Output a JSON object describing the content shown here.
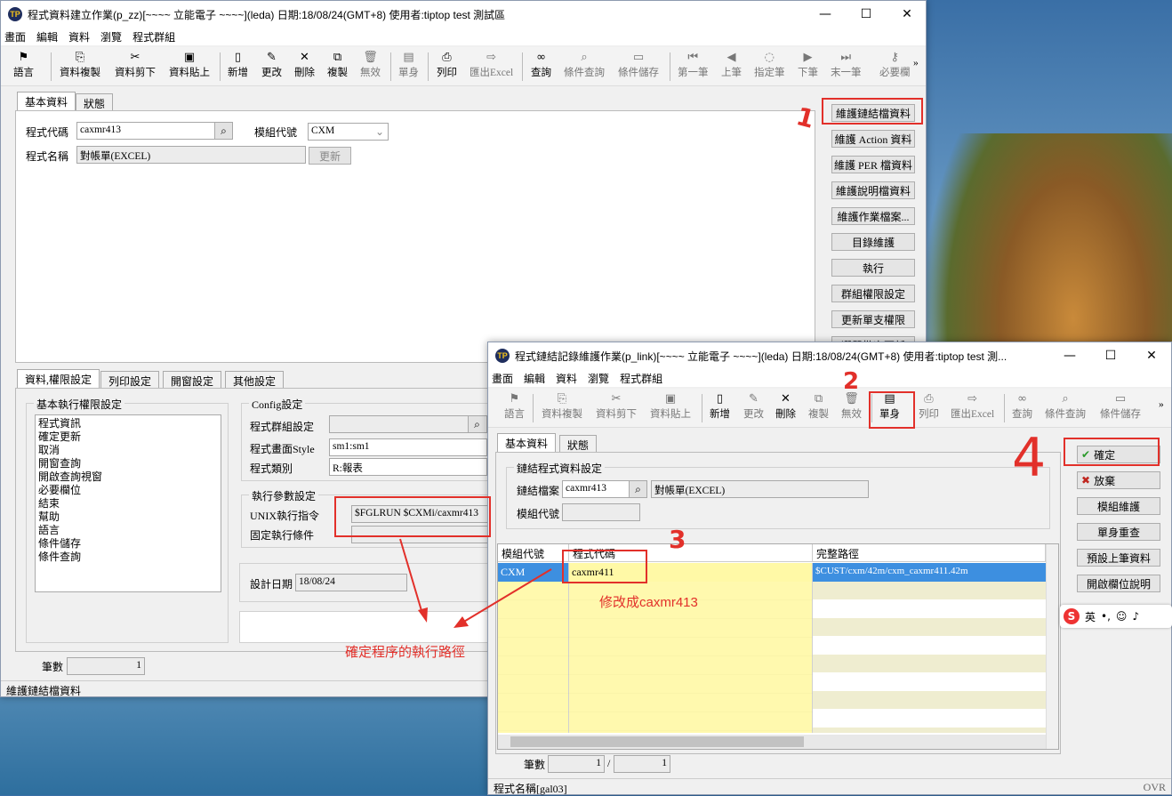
{
  "main": {
    "title": "程式資料建立作業(p_zz)[~~~~ 立能電子 ~~~~](leda) 日期:18/08/24(GMT+8) 使用者:tiptop test 測試區",
    "menu": [
      "畫面",
      "編輯",
      "資料",
      "瀏覽",
      "程式群組"
    ],
    "toolbar": [
      "語言",
      "資料複製",
      "資料剪下",
      "資料貼上",
      "新增",
      "更改",
      "刪除",
      "複製",
      "無效",
      "單身",
      "列印",
      "匯出Excel",
      "查詢",
      "條件查詢",
      "條件儲存",
      "第一筆",
      "上筆",
      "指定筆",
      "下筆",
      "末一筆",
      "必要欄"
    ],
    "tabs": [
      "基本資料",
      "狀態"
    ],
    "prog_code_label": "程式代碼",
    "prog_code": "caxmr413",
    "module_label": "模組代號",
    "module": "CXM",
    "prog_name_label": "程式名稱",
    "prog_name": "對帳單(EXCEL)",
    "update_btn": "更新",
    "side_buttons": [
      "維護鏈結檔資料",
      "維護 Action 資料",
      "維護 PER 檔資料",
      "維護說明檔資料",
      "維護作業檔案...",
      "目錄維護",
      "執行",
      "群組權限設定",
      "更新單支權限",
      "選單批次更新"
    ],
    "lower_tabs": [
      "資料,權限設定",
      "列印設定",
      "開窗設定",
      "其他設定"
    ],
    "perm_group": "基本執行權限設定",
    "perm_items": [
      "程式資訊",
      "確定更新",
      "取消",
      "開窗查詢",
      "開啟查詢視窗",
      "必要欄位",
      "結束",
      "幫助",
      "語言",
      "條件儲存",
      "條件查詢"
    ],
    "config_group": "Config設定",
    "cfg_group_label": "程式群組設定",
    "cfg_style_label": "程式畫面Style",
    "cfg_style": "sm1:sm1",
    "cfg_type_label": "程式類別",
    "cfg_type": "R:報表",
    "exec_group": "執行參數設定",
    "unix_label": "UNIX執行指令",
    "unix_cmd": "$FGLRUN $CXMi/caxmr413",
    "fixed_label": "固定執行條件",
    "design_label": "設計日期",
    "design_date": "18/08/24",
    "count_label": "筆數",
    "count": "1",
    "status": "維護鏈結檔資料"
  },
  "link": {
    "title": "程式鏈結記錄維護作業(p_link)[~~~~ 立能電子 ~~~~](leda) 日期:18/08/24(GMT+8) 使用者:tiptop test 測...",
    "menu": [
      "畫面",
      "編輯",
      "資料",
      "瀏覽",
      "程式群組"
    ],
    "toolbar": [
      "語言",
      "資料複製",
      "資料剪下",
      "資料貼上",
      "新增",
      "更改",
      "刪除",
      "複製",
      "無效",
      "單身",
      "列印",
      "匯出Excel",
      "查詢",
      "條件查詢",
      "條件儲存"
    ],
    "tabs": [
      "基本資料",
      "狀態"
    ],
    "group": "鏈結程式資料設定",
    "link_file_label": "鏈結檔案",
    "link_file": "caxmr413",
    "link_name": "對帳單(EXCEL)",
    "module_label": "模組代號",
    "cols": [
      "模組代號",
      "程式代碼",
      "完整路徑"
    ],
    "row": [
      "CXM",
      "caxmr411",
      "$CUST/cxm/42m/cxm_caxmr411.42m"
    ],
    "side_buttons": [
      "確定",
      "放棄",
      "模組維護",
      "單身重查",
      "預設上筆資料",
      "開啟欄位說明"
    ],
    "count_label": "筆數",
    "count": "1",
    "total": "1",
    "status": "程式名稱[gal03]",
    "ovr": "OVR"
  },
  "notes": {
    "n1": "1",
    "n2": "2",
    "n3": "3",
    "n4": "4",
    "modify": "修改成caxmr413",
    "confirm_path": "確定程序的執行路徑"
  },
  "ime": {
    "lang": "英"
  }
}
